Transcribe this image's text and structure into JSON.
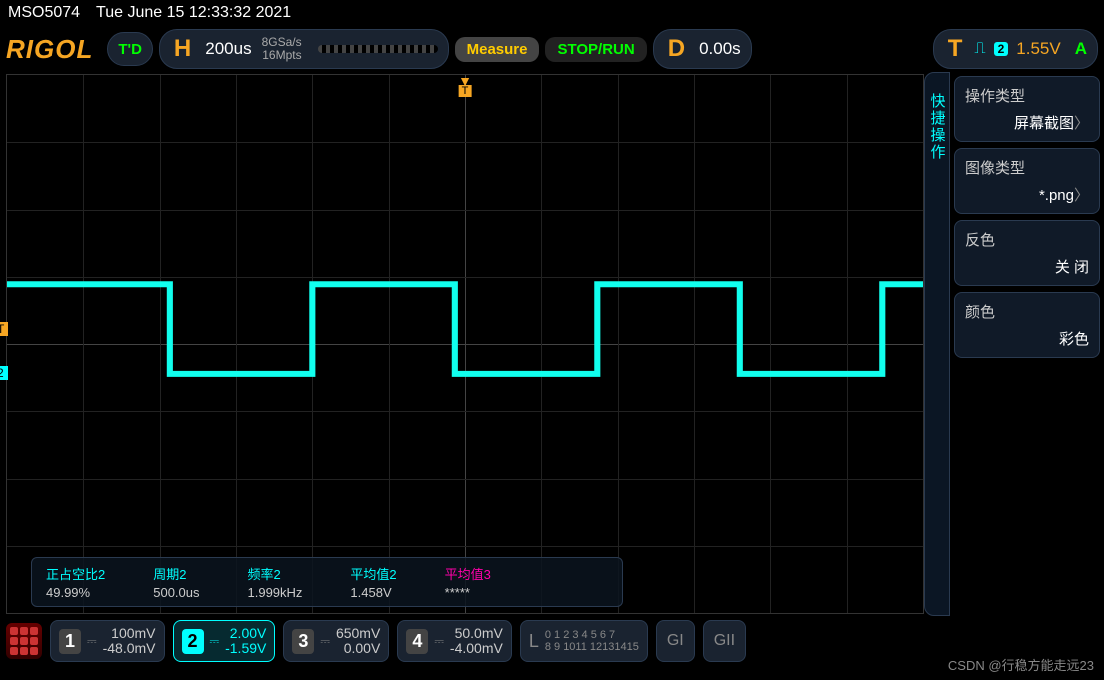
{
  "header": {
    "model": "MSO5074",
    "datetime": "Tue June 15 12:33:32 2021"
  },
  "toolbar": {
    "brand": "RIGOL",
    "status": "T'D",
    "h_label": "H",
    "timebase": "200us",
    "sample_rate": "8GSa/s",
    "mem_depth": "16Mpts",
    "measure_btn": "Measure",
    "stoprun_btn": "STOP/RUN",
    "d_label": "D",
    "delay": "0.00s",
    "t_label": "T",
    "trig_ch": "2",
    "trig_level": "1.55V",
    "trig_mode": "A"
  },
  "side_tab": "快捷操作",
  "menu": [
    {
      "title": "操作类型",
      "value": "屏幕截图"
    },
    {
      "title": "图像类型",
      "value": "*.png"
    },
    {
      "title": "反色",
      "value": "关 闭"
    },
    {
      "title": "颜色",
      "value": "彩色"
    }
  ],
  "trigger_top_marker": "T",
  "t_level_marker": "T",
  "ch2_gnd_marker": "2",
  "measurements": [
    {
      "name": "正占空比2",
      "value": "49.99%",
      "cls": ""
    },
    {
      "name": "周期2",
      "value": "500.0us",
      "cls": ""
    },
    {
      "name": "频率2",
      "value": "1.999kHz",
      "cls": ""
    },
    {
      "name": "平均值2",
      "value": "1.458V",
      "cls": ""
    },
    {
      "name": "平均值3",
      "value": "*****",
      "cls": "pink"
    }
  ],
  "channels": [
    {
      "n": "1",
      "scale": "100mV",
      "offset": "-48.0mV",
      "active": false
    },
    {
      "n": "2",
      "scale": "2.00V",
      "offset": "-1.59V",
      "active": true
    },
    {
      "n": "3",
      "scale": "650mV",
      "offset": "0.00V",
      "active": false
    },
    {
      "n": "4",
      "scale": "50.0mV",
      "offset": "-4.00mV",
      "active": false
    }
  ],
  "logic": {
    "label": "L",
    "line1": "0 1 2 3  4 5 6 7",
    "line2": "8 9 1011 12131415"
  },
  "g_boxes": [
    "GI",
    "GII"
  ],
  "watermark": "CSDN @行稳方能走远23"
}
